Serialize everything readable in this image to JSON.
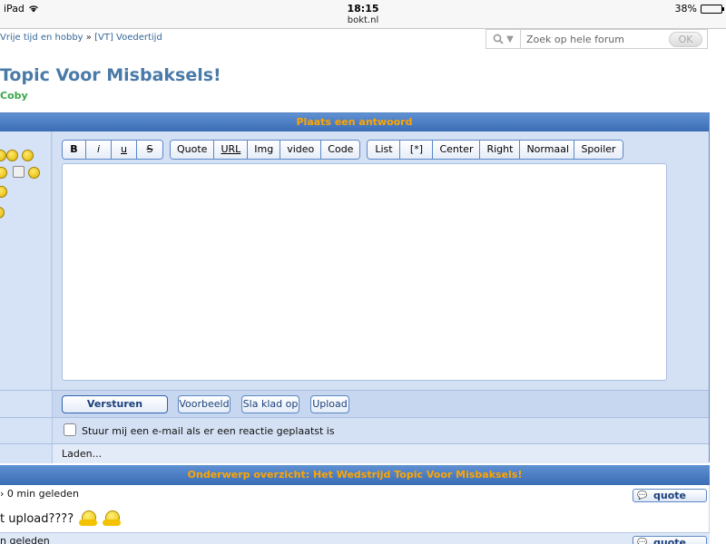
{
  "status_bar": {
    "device": "iPad",
    "time": "18:15",
    "battery_percent": "38%",
    "battery_level": 0.38
  },
  "browser": {
    "url": "bokt.nl"
  },
  "breadcrumb": {
    "parent": "Vrije tijd en hobby",
    "separator": "»",
    "current": "[VT] Voedertijd"
  },
  "search": {
    "placeholder": "Zoek op hele forum",
    "submit_label": "OK"
  },
  "topic": {
    "title": "Topic Voor Misbaksels!",
    "author": "Coby"
  },
  "reply": {
    "header": "Plaats een antwoord",
    "toolbar_groups": [
      [
        "B",
        "i",
        "u",
        "S"
      ],
      [
        "Quote",
        "URL",
        "Img",
        "video",
        "Code"
      ],
      [
        "List",
        "[*]",
        "Center",
        "Right",
        "Normaal",
        "Spoiler"
      ]
    ],
    "buttons": {
      "send": "Versturen",
      "preview": "Voorbeeld",
      "save_draft": "Sla klad op",
      "upload": "Upload"
    },
    "email_notify_label": "Stuur mij een e-mail als er een reactie geplaatst is",
    "loading_text": "Laden..."
  },
  "overview": {
    "header": "Onderwerp overzicht: Het Wedstrijd Topic Voor Misbaksels!",
    "quote_label": "quote",
    "posts": [
      {
        "meta": "› 0 min geleden",
        "text": "t upload????"
      },
      {
        "meta": "n geleden"
      }
    ]
  }
}
